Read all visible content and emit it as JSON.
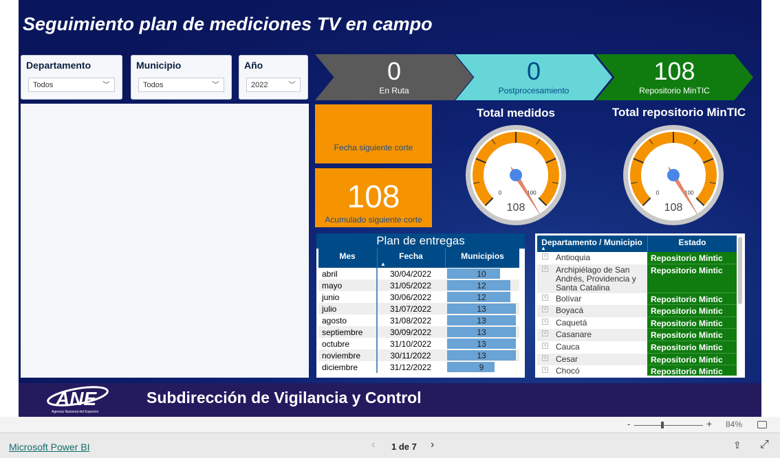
{
  "title": "Seguimiento plan de mediciones TV en campo",
  "filters": [
    {
      "label": "Departamento",
      "value": "Todos"
    },
    {
      "label": "Municipio",
      "value": "Todos"
    },
    {
      "label": "Año",
      "value": "2022"
    }
  ],
  "kpis": [
    {
      "value": "0",
      "label": "En Ruta",
      "color": "#5a5a5a",
      "text": "#ffffff"
    },
    {
      "value": "0",
      "label": "Postprocesamiento",
      "color": "#66d6d8",
      "text": "#004b87"
    },
    {
      "value": "108",
      "label": "Repositorio MinTIC",
      "color": "#107c10",
      "text": "#ffffff"
    }
  ],
  "fecha_corte": {
    "label": "Fecha siguiente corte",
    "value": ""
  },
  "acumulado": {
    "value": "108",
    "label": "Acumulado siguiente corte"
  },
  "gauges": [
    {
      "title": "Total medidos",
      "value": 108,
      "min": 0,
      "max": 100,
      "min_label": "0",
      "max_label": "100",
      "value_label": "108"
    },
    {
      "title": "Total repositorio MinTIC",
      "value": 108,
      "min": 0,
      "max": 100,
      "min_label": "0",
      "max_label": "100",
      "value_label": "108"
    }
  ],
  "plan": {
    "title": "Plan de entregas",
    "headers": [
      "Mes",
      "Fecha",
      "Municipios"
    ],
    "max": 13,
    "rows": [
      [
        "abril",
        "30/04/2022",
        10
      ],
      [
        "mayo",
        "31/05/2022",
        12
      ],
      [
        "junio",
        "30/06/2022",
        12
      ],
      [
        "julio",
        "31/07/2022",
        13
      ],
      [
        "agosto",
        "31/08/2022",
        13
      ],
      [
        "septiembre",
        "30/09/2022",
        13
      ],
      [
        "octubre",
        "31/10/2022",
        13
      ],
      [
        "noviembre",
        "30/11/2022",
        13
      ],
      [
        "diciembre",
        "31/12/2022",
        9
      ]
    ]
  },
  "estado": {
    "headers": [
      "Departamento / Municipio",
      "Estado"
    ],
    "rows": [
      [
        "Antioquia",
        "Repositorio Mintic"
      ],
      [
        "Archipiélago de San Andrés, Providencia y Santa Catalina",
        "Repositorio Mintic"
      ],
      [
        "Bolívar",
        "Repositorio Mintic"
      ],
      [
        "Boyacá",
        "Repositorio Mintic"
      ],
      [
        "Caquetá",
        "Repositorio Mintic"
      ],
      [
        "Casanare",
        "Repositorio Mintic"
      ],
      [
        "Cauca",
        "Repositorio Mintic"
      ],
      [
        "Cesar",
        "Repositorio Mintic"
      ],
      [
        "Chocó",
        "Repositorio Mintic"
      ]
    ]
  },
  "footer": {
    "logo": "ANE",
    "logo_sub": "Agencia Nacional del Espectro",
    "text": "Subdirección de Vigilancia y Control"
  },
  "zoom": {
    "minus": "-",
    "plus": "+",
    "level": "84%"
  },
  "nav": {
    "brand": "Microsoft Power BI",
    "page": "1 de 7",
    "prev": "‹",
    "next": "›"
  },
  "colors": {
    "orange": "#f59300",
    "header": "#004b87",
    "green": "#107c10",
    "bar": "#6aa3d5"
  }
}
